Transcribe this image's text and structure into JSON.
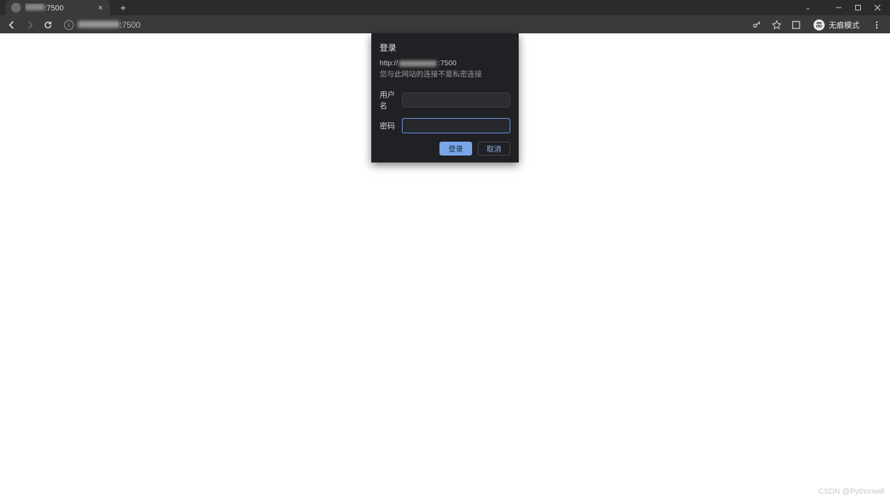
{
  "tab": {
    "title_suffix": ":7500"
  },
  "address": {
    "url_prefix": "",
    "url_suffix": ":7500"
  },
  "toolbar": {
    "incognito_label": "无痕模式"
  },
  "auth": {
    "title": "登录",
    "url_prefix": "http://",
    "url_suffix": ":7500",
    "warning": "您与此网站的连接不是私密连接",
    "username_label": "用户名",
    "password_label": "密码",
    "username_value": "",
    "password_value": "",
    "login_button": "登录",
    "cancel_button": "取消"
  },
  "watermark": "CSDN @Pythonwill"
}
